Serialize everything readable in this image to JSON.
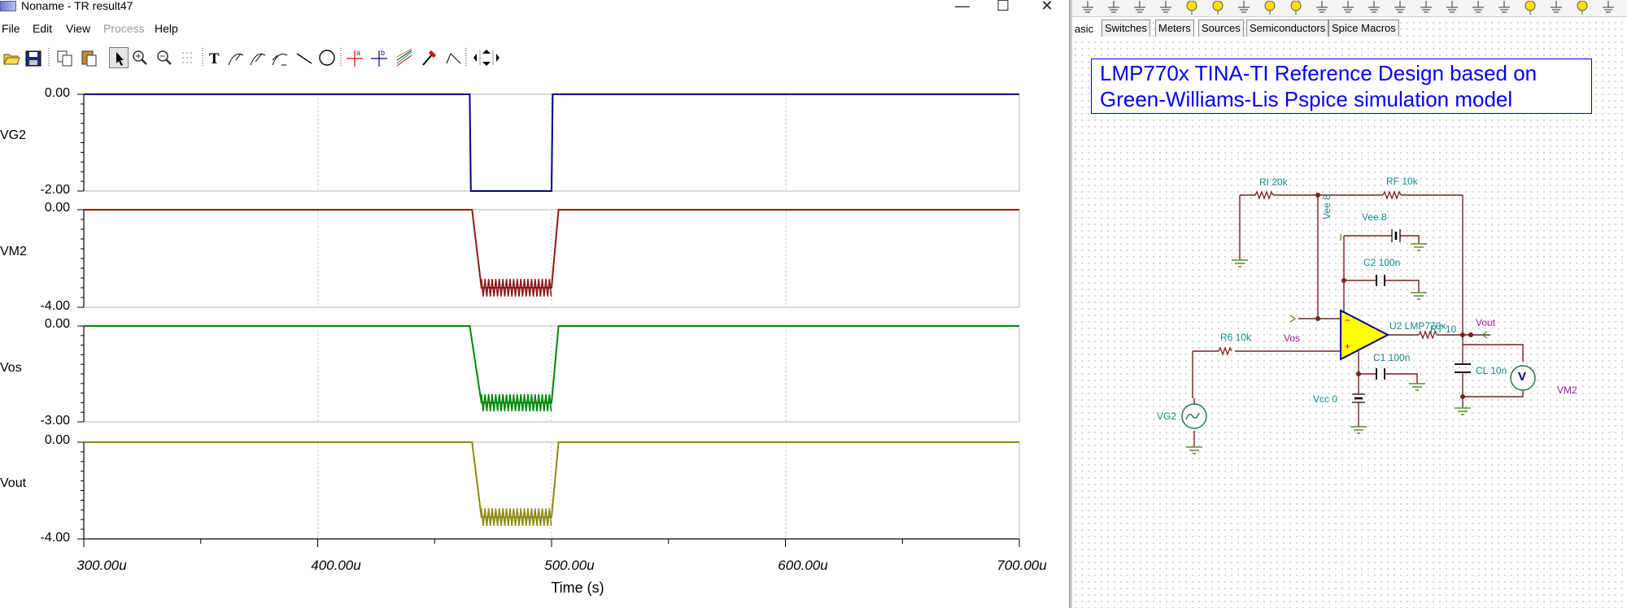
{
  "window": {
    "title": "Noname - TR result47",
    "controls": {
      "minimize": "—",
      "maximize": "☐",
      "close": "✕"
    }
  },
  "menu": {
    "items": [
      {
        "label": "File",
        "enabled": true
      },
      {
        "label": "Edit",
        "enabled": true
      },
      {
        "label": "View",
        "enabled": true
      },
      {
        "label": "Process",
        "enabled": false
      },
      {
        "label": "Help",
        "enabled": true
      }
    ]
  },
  "toolbar": {
    "buttons": [
      "open-icon",
      "save-icon",
      "copy-icon",
      "paste-icon",
      "pointer-icon",
      "zoom-in-icon",
      "zoom-out-icon",
      "grid-icon",
      "text-icon",
      "curve-label-icon",
      "auto-label-icon",
      "multi-label-icon",
      "line-icon",
      "circle-icon",
      "cursor-a-icon",
      "cursor-b-icon",
      "curves-icon",
      "probe-icon",
      "step-icon",
      "arrows-icon"
    ]
  },
  "plot": {
    "x_axis_title": "Time (s)",
    "x_ticks": [
      "300.00u",
      "400.00u",
      "500.00u",
      "600.00u",
      "700.00u"
    ],
    "traces": [
      {
        "name": "VG2",
        "y_top": "0.00",
        "y_bottom": "-2.00",
        "color": "#00008b"
      },
      {
        "name": "VM2",
        "y_top": "0.00",
        "y_bottom": "-4.00",
        "color": "#8b1a1a"
      },
      {
        "name": "Vos",
        "y_top": "0.00",
        "y_bottom": "-3.00",
        "color": "#00870a"
      },
      {
        "name": "Vout",
        "y_top": "0.00",
        "y_bottom": "-4.00",
        "color": "#8b8b10"
      }
    ]
  },
  "chart_data": [
    {
      "type": "line",
      "title": "VG2",
      "xlabel": "Time (s)",
      "xlim": [
        300,
        700
      ],
      "ylim": [
        -2,
        0
      ],
      "series": [
        {
          "name": "VG2",
          "x": [
            300,
            465,
            465.5,
            500,
            500.5,
            700
          ],
          "y": [
            0,
            0,
            -2,
            -2,
            0,
            0
          ]
        }
      ]
    },
    {
      "type": "line",
      "title": "VM2",
      "xlabel": "Time (s)",
      "xlim": [
        300,
        700
      ],
      "ylim": [
        -4,
        0
      ],
      "series": [
        {
          "name": "VM2",
          "x": [
            300,
            466,
            470,
            485,
            496,
            500,
            503,
            700
          ],
          "y": [
            0,
            0,
            -3.2,
            -3.2,
            -3.2,
            -3.2,
            0,
            0
          ]
        }
      ]
    },
    {
      "type": "line",
      "title": "Vos",
      "xlabel": "Time (s)",
      "xlim": [
        300,
        700
      ],
      "ylim": [
        -3,
        0
      ],
      "series": [
        {
          "name": "Vos",
          "x": [
            300,
            465,
            470,
            485,
            496,
            500,
            503,
            700
          ],
          "y": [
            0,
            0,
            -2.4,
            -2.4,
            -2.4,
            -2.4,
            0,
            0
          ]
        }
      ]
    },
    {
      "type": "line",
      "title": "Vout",
      "xlabel": "Time (s)",
      "xlim": [
        300,
        700
      ],
      "ylim": [
        -4,
        0
      ],
      "series": [
        {
          "name": "Vout",
          "x": [
            300,
            466,
            470,
            485,
            496,
            500,
            503,
            700
          ],
          "y": [
            0,
            0,
            -3.1,
            -3.1,
            -3.1,
            -3.1,
            0,
            0
          ]
        }
      ]
    }
  ],
  "schematic": {
    "tabs": [
      {
        "label": "asic",
        "active": true
      },
      {
        "label": "Switches",
        "active": false
      },
      {
        "label": "Meters",
        "active": false
      },
      {
        "label": "Sources",
        "active": false
      },
      {
        "label": "Semiconductors",
        "active": false
      },
      {
        "label": "Spice Macros",
        "active": false
      }
    ],
    "title_lines": [
      "LMP770x TINA-TI Reference Design based on",
      "Green-Williams-Lis Pspice simulation model"
    ],
    "labels": {
      "ri": "RI 20k",
      "rf": "RF 10k",
      "vee_v": "Vee 8",
      "vee": "Vee 8",
      "c2": "C2 100n",
      "u2": "U2 LMP770x",
      "rt": "RT 10",
      "vout": "Vout",
      "r6": "R6 10k",
      "vos": "Vos",
      "c1": "C1 100n",
      "cl": "CL 10n",
      "vm2": "VM2",
      "vcc": "Vcc 0",
      "vg2": "VG2",
      "vm_symbol": "V"
    }
  }
}
